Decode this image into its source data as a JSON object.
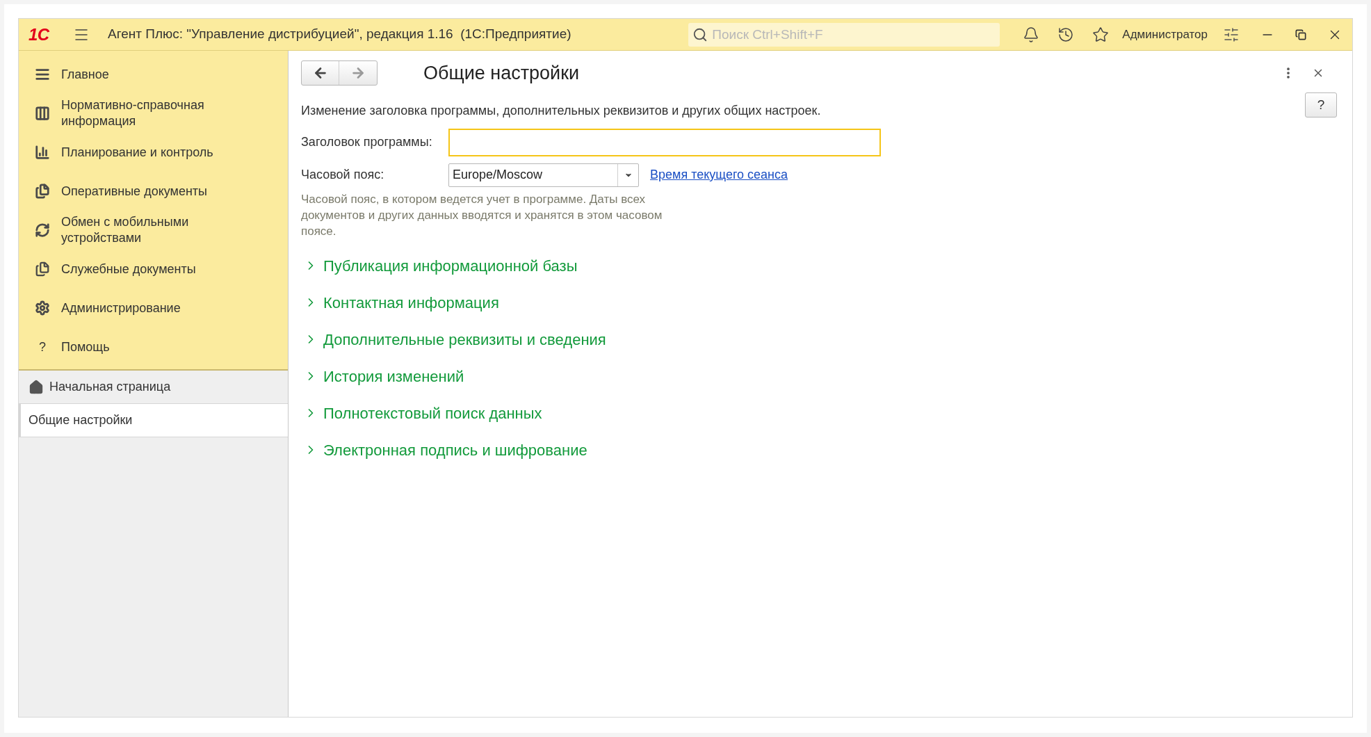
{
  "window": {
    "title": "Агент Плюс: \"Управление дистрибуцией\", редакция 1.16  (1С:Предприятие)",
    "logo": "1С",
    "search_placeholder": "Поиск Ctrl+Shift+F",
    "user": "Администратор"
  },
  "sidebar": {
    "items": [
      {
        "label": "Главное",
        "kind": "lines"
      },
      {
        "label": "Нормативно-справочная информация",
        "kind": "columns"
      },
      {
        "label": "Планирование и контроль",
        "kind": "chart"
      },
      {
        "label": "Оперативные документы",
        "kind": "docs"
      },
      {
        "label": "Обмен с мобильными устройствами",
        "kind": "sync"
      },
      {
        "label": "Служебные документы",
        "kind": "servicedocs"
      },
      {
        "label": "Администрирование",
        "kind": "gear"
      },
      {
        "label": "Помощь",
        "kind": "help",
        "glyph": "?"
      }
    ],
    "history": [
      {
        "label": "Начальная страница",
        "home": true,
        "selected": false
      },
      {
        "label": "Общие настройки",
        "home": false,
        "selected": true
      }
    ]
  },
  "form": {
    "title": "Общие настройки",
    "help_button": "?",
    "description": "Изменение заголовка программы, дополнительных реквизитов и других общих настроек.",
    "fields": [
      {
        "label": "Заголовок программы:",
        "kind": "text",
        "focused": true
      },
      {
        "label": "Часовой пояс:",
        "kind": "select",
        "value": "Europe/Moscow",
        "link": "Время текущего сеанса"
      }
    ],
    "hint": "Часовой пояс, в котором ведется учет в программе. Даты всех документов и других данных вводятся и хранятся в этом часовом поясе.",
    "groups": [
      {
        "label": "Публикация информационной базы",
        "expanded": false
      },
      {
        "label": "Контактная информация",
        "expanded": false
      },
      {
        "label": "Дополнительные реквизиты и сведения",
        "expanded": false
      },
      {
        "label": "История изменений",
        "expanded": false
      },
      {
        "label": "Полнотекстовый поиск данных",
        "expanded": false
      },
      {
        "label": "Электронная подпись и шифрование",
        "expanded": false
      }
    ]
  }
}
